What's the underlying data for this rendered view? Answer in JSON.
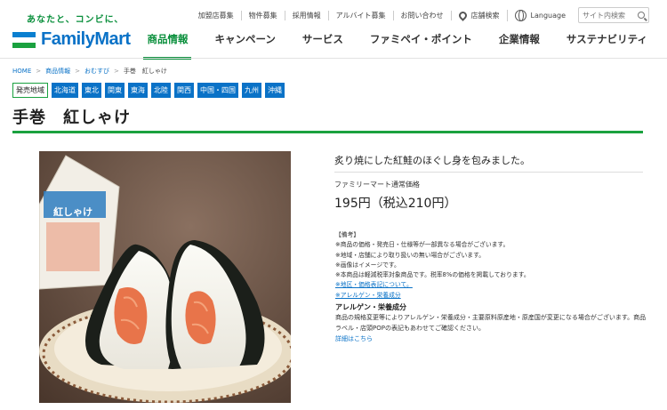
{
  "header": {
    "tagline": "あなたと、コンビに、",
    "logo_text": "FamilyMart",
    "utility_links": [
      "加盟店募集",
      "物件募集",
      "採用情報",
      "アルバイト募集",
      "お問い合わせ"
    ],
    "store_search": "店舗検索",
    "language": "Language",
    "search_placeholder": "サイト内検索",
    "nav": [
      "商品情報",
      "キャンペーン",
      "サービス",
      "ファミペイ・ポイント",
      "企業情報",
      "サステナビリティ"
    ]
  },
  "breadcrumb": [
    "HOME",
    "商品情報",
    "おむすび",
    "手巻　紅しゃけ"
  ],
  "regions": {
    "label": "発売地域",
    "items": [
      "北海道",
      "東北",
      "関東",
      "東海",
      "北陸",
      "関西",
      "中国・四国",
      "九州",
      "沖縄"
    ]
  },
  "product": {
    "title": "手巻　紅しゃけ",
    "lead": "炙り焼にした紅鮭のほぐし身を包みました。",
    "price_label": "ファミリーマート通常価格",
    "price": "195円（税込210円）",
    "package_text": "紅しゃけ"
  },
  "notes": {
    "heading": "【備考】",
    "lines": [
      "※商品の価格・発売日・仕様等が一部異なる場合がございます。",
      "※地域・店舗により取り扱いの無い場合がございます。",
      "※画像はイメージです。",
      "※本商品は軽減税率対象商品です。税率8%の価格を掲載しております。"
    ],
    "link_region_price": "※地区・価格表記について。",
    "link_allergy": "※アレルゲン・栄養成分"
  },
  "allergy": {
    "heading": "アレルゲン・栄養成分",
    "body": "商品の規格変更等によりアレルゲン・栄養成分・主要原料原産地・原産国が変更になる場合がございます。商品ラベル・店頭POPの表記もあわせてご確認ください。",
    "detail_link": "詳細はこちら"
  }
}
